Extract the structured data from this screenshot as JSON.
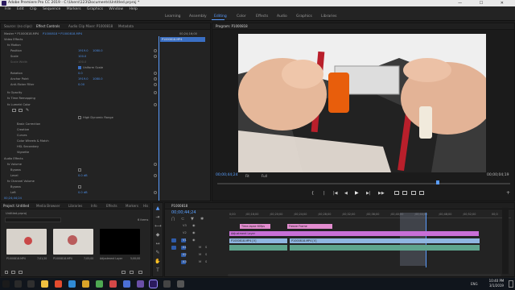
{
  "app": {
    "title": "Adobe Premiere Pro CC 2019 - C:\\Users\\123\\Documents\\Untitled.prproj *",
    "window_controls": [
      "—",
      "☐",
      "✕"
    ]
  },
  "menu": [
    "File",
    "Edit",
    "Clip",
    "Sequence",
    "Markers",
    "Graphics",
    "Window",
    "Help"
  ],
  "workspaces": {
    "items": [
      "Learning",
      "Assembly",
      "Editing",
      "Color",
      "Effects",
      "Audio",
      "Graphics",
      "Libraries"
    ],
    "active": "Editing"
  },
  "source_panel": {
    "tabs": [
      "Source: (no clips)",
      "Effect Controls",
      "Audio Clip Mixer: P1000818",
      "Metadata"
    ],
    "active_tab": "Effect Controls",
    "master_label": "Master * P1000818.MP4",
    "sequence_label": "P1000818 * P1000818.MP4",
    "timecode_head": "00;24;16;00",
    "clip_block_label": "P1000818.MP4",
    "sections": {
      "video_effects": "Video Effects",
      "motion": "Motion",
      "position": {
        "label": "Position",
        "x": "1919.0",
        "y": "1080.0"
      },
      "scale": {
        "label": "Scale",
        "value": "100.0"
      },
      "scale_width": {
        "label": "Scale Width",
        "value": "100.0"
      },
      "uniform_scale": "Uniform Scale",
      "rotation": {
        "label": "Rotation",
        "value": "0.0"
      },
      "anchor_point": {
        "label": "Anchor Point",
        "x": "1919.0",
        "y": "1080.0"
      },
      "anti_flicker": {
        "label": "Anti-flicker Filter",
        "value": "0.00"
      },
      "opacity": "Opacity",
      "time_remapping": "Time Remapping",
      "lumetri": "Lumetri Color",
      "high_dynamic_range": "High Dynamic Range",
      "lumetri_items": [
        "Basic Correction",
        "Creative",
        "Curves",
        "Color Wheels & Match",
        "HSL Secondary",
        "Vignette"
      ],
      "audio_effects": "Audio Effects",
      "volume": "Volume",
      "bypass": "Bypass",
      "level": {
        "label": "Level",
        "value": "0.0 dB"
      },
      "channel_volume": "Channel Volume",
      "left": {
        "label": "Left",
        "value": "0.0 dB"
      },
      "bypass2": "Bypass"
    },
    "bottom_timecode": "00;24;44;24"
  },
  "program_monitor": {
    "title": "Program: P1000818",
    "timecode": "00;00;44;24",
    "fit": "Fit",
    "quality": "Full",
    "duration": "00;00;04;19",
    "transport": [
      "{",
      "|",
      "|◀",
      "◀",
      "▶",
      "▶|",
      "▶▶"
    ]
  },
  "project_panel": {
    "tabs": [
      "Project: Untitled",
      "Media Browser",
      "Libraries",
      "Info",
      "Effects",
      "Markers",
      "His"
    ],
    "active_tab": "Project: Untitled",
    "file": "Untitled.prproj",
    "item_count": "6 items",
    "items": [
      {
        "name": "P1000818.MP4",
        "duration": "7;01;20"
      },
      {
        "name": "P1000818.MP4",
        "duration": "7;05;00"
      },
      {
        "name": "Adjustment Layer",
        "duration": "5;00;00"
      }
    ]
  },
  "timeline": {
    "tab": "P1000818",
    "timecode": "00;00;44;24",
    "ruler": [
      "0;00",
      ";00;16;00",
      ";00;20;00",
      ";00;24;00",
      ";00;28;00",
      ";00;32;00",
      ";00;36;00",
      ";00;40;00",
      ";00;44;00",
      ";00;48;00",
      ";00;52;00",
      "00;0"
    ],
    "tracks": [
      {
        "name": "V3"
      },
      {
        "name": "V2"
      },
      {
        "name": "V1"
      },
      {
        "name": "A1"
      },
      {
        "name": "A2"
      },
      {
        "name": "A3"
      }
    ],
    "clips": {
      "v3a": "Time-lapse 60fps",
      "v3b": "Freeze Frame",
      "v2": "Adjustment Layer",
      "v1a": "P1000818.MP4 [V]",
      "v1b": "P1000818.MP4 [V]"
    }
  },
  "taskbar": {
    "time": "10:40 PM",
    "date": "3/1/2019",
    "lang": "ENG"
  },
  "colors": {
    "accent": "#5a9cff",
    "clip_pink": "#e38ccf",
    "clip_blue": "#8fb5e0",
    "adjust_purple": "#c86fd7"
  }
}
